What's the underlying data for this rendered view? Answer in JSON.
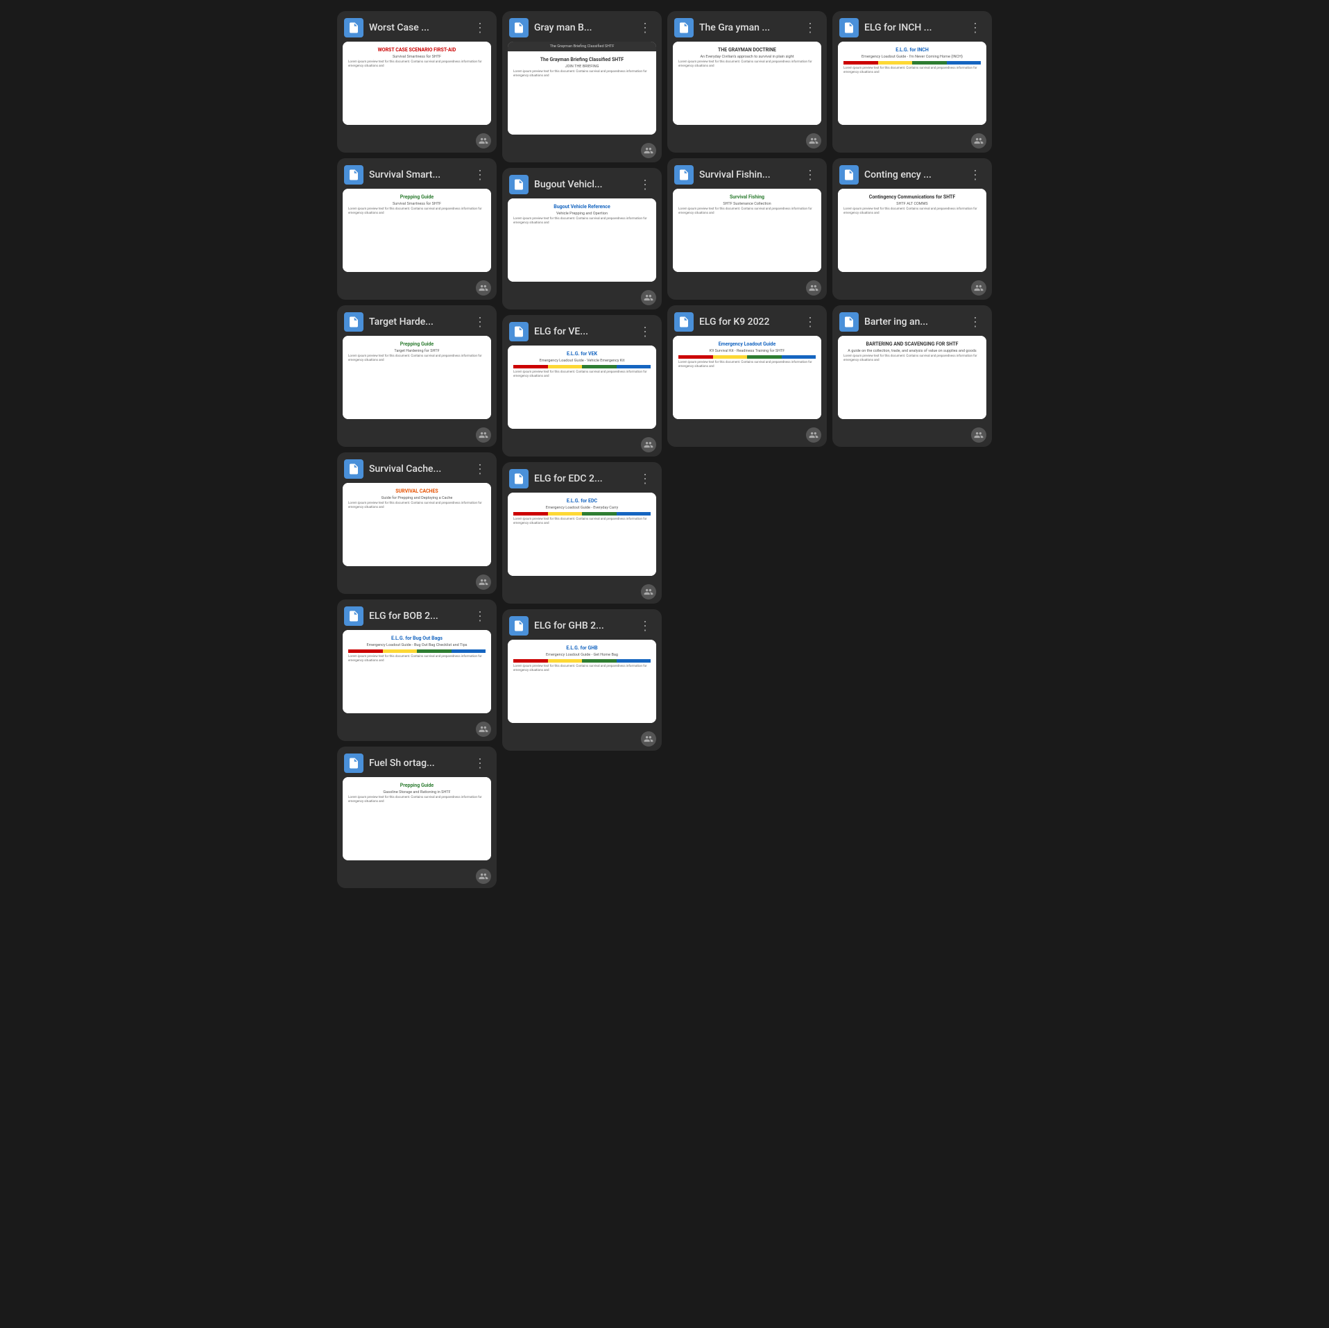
{
  "cards_col1": [
    {
      "id": "worst-case",
      "title": "Worst Case ...",
      "thumb_title": "WORST CASE SCENARIO FIRST-AID",
      "thumb_sub": "Survival Smartness for SHTF",
      "thumb_color": "red"
    },
    {
      "id": "survival-smart",
      "title": "Survival Smart...",
      "thumb_title": "Prepping Guide",
      "thumb_sub": "Survival Smartness for SHTF",
      "thumb_color": "green"
    },
    {
      "id": "target-harde",
      "title": "Target Harde...",
      "thumb_title": "Prepping Guide",
      "thumb_sub": "Target Hardening for SHTF",
      "thumb_color": "green"
    },
    {
      "id": "survival-cache",
      "title": "Survival Cache...",
      "thumb_title": "SURVIVAL CACHES",
      "thumb_sub": "Guide for Prepping and Deploying a Cache",
      "thumb_color": "orange"
    },
    {
      "id": "elg-bob",
      "title": "ELG for BOB 2...",
      "thumb_title": "E.L.G. for Bug Out Bags",
      "thumb_sub": "Emergency Loadout Guide - Bug Out Bag Checklist and Tips",
      "thumb_color": "blue",
      "has_colorbar": true
    },
    {
      "id": "fuel-shortag",
      "title": "Fuel Sh ortag...",
      "thumb_title": "Prepping Guide",
      "thumb_sub": "Gasoline Storage and Rationing in SHTF",
      "thumb_color": "green"
    }
  ],
  "cards_col2": [
    {
      "id": "grayman-b",
      "title": "Gray man B...",
      "thumb_title": "The Grayman Briefing Classified SHTF",
      "thumb_sub": "JOIN THE BRIEFING",
      "thumb_color": "dark"
    },
    {
      "id": "bugout-vehicl",
      "title": "Bugout Vehicl...",
      "thumb_title": "Bugout Vehicle Reference",
      "thumb_sub": "Vehicle Prepping and Opertion",
      "thumb_color": "blue"
    },
    {
      "id": "elg-ve",
      "title": "ELG for VE...",
      "thumb_title": "E.L.G. for VEK",
      "thumb_sub": "Emergency Loadout Guide - Vehicle Emergency Kit",
      "thumb_color": "blue",
      "has_colorbar": true
    },
    {
      "id": "elg-edc2",
      "title": "ELG for EDC 2...",
      "thumb_title": "E.L.G. for EDC",
      "thumb_sub": "Emergency Loadout Guide - Everyday Carry",
      "thumb_color": "blue",
      "has_colorbar": true
    },
    {
      "id": "elg-ghb2",
      "title": "ELG for GHB 2...",
      "thumb_title": "E.L.G. for GHB",
      "thumb_sub": "Emergency Loadout Guide - Get Home Bag",
      "thumb_color": "blue",
      "has_colorbar": true
    }
  ],
  "cards_right_top": [
    {
      "id": "grayman-doc",
      "title": "The Gra yman ...",
      "thumb_title": "THE GRAYMAN DOCTRINE",
      "thumb_sub": "An Everyday Civilian's approach to survival in plain sight",
      "thumb_color": "dark"
    },
    {
      "id": "elg-inch",
      "title": "ELG for INCH ...",
      "thumb_title": "E.L.G. for INCH",
      "thumb_sub": "Emergency Loadout Guide - I'm Never Coming Home (INCH)",
      "thumb_color": "blue",
      "has_colorbar": true
    }
  ],
  "cards_right_mid": [
    {
      "id": "survival-fishing",
      "title": "Survival Fishin...",
      "thumb_title": "Survival Fishing",
      "thumb_sub": "SHTF Sustenance Collection",
      "thumb_color": "green"
    },
    {
      "id": "contingency",
      "title": "Conting ency ...",
      "thumb_title": "Contingency Communications for SHTF",
      "thumb_sub": "SHTF ALT COMMS",
      "thumb_color": "dark"
    }
  ],
  "cards_right_bot": [
    {
      "id": "elg-k9",
      "title": "ELG for K9 2022",
      "thumb_title": "Emergency Loadout Guide",
      "thumb_sub": "K9 Survival Kit - Readiness Training for SHTF",
      "thumb_color": "blue",
      "has_colorbar": true
    },
    {
      "id": "bartering",
      "title": "Barter ing an...",
      "thumb_title": "BARTERING AND SCAVENGING FOR SHTF",
      "thumb_sub": "A guide on the collection, trade, and analysis of value on supplies and goods",
      "thumb_color": "dark"
    }
  ],
  "labels": {
    "menu_dots": "⋮",
    "doc_icon_title": "Document"
  }
}
